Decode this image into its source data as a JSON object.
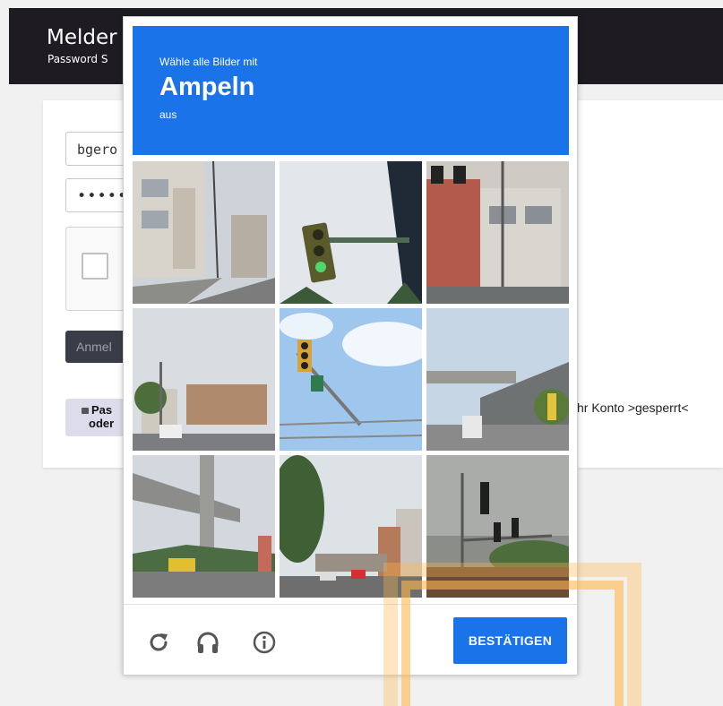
{
  "page": {
    "title": "Melder",
    "subtitle": "Password S",
    "username_value": "bgero",
    "password_value": "••••••",
    "login_label": "Anmel",
    "help_line1": "Pas",
    "help_line2": "oder",
    "account_text": "hr Konto >gesperrt<"
  },
  "captcha": {
    "prompt_small": "Wähle alle Bilder mit",
    "prompt_big": "Ampeln",
    "prompt_suffix": "aus",
    "tiles": [
      {
        "desc": "street-buildings"
      },
      {
        "desc": "traffic-light-closeup"
      },
      {
        "desc": "building-pole"
      },
      {
        "desc": "street-apartments"
      },
      {
        "desc": "traffic-light-sky"
      },
      {
        "desc": "road-bridge"
      },
      {
        "desc": "overpass-street"
      },
      {
        "desc": "city-street-trees"
      },
      {
        "desc": "traffic-lights-road"
      }
    ],
    "footer": {
      "reload_icon": "reload-icon",
      "audio_icon": "headphones-icon",
      "info_icon": "info-icon",
      "verify_label": "BESTÄTIGEN"
    }
  },
  "colors": {
    "accent": "#1a73e8",
    "topbar": "#1e1b23",
    "highlight": "#ffb74c"
  }
}
